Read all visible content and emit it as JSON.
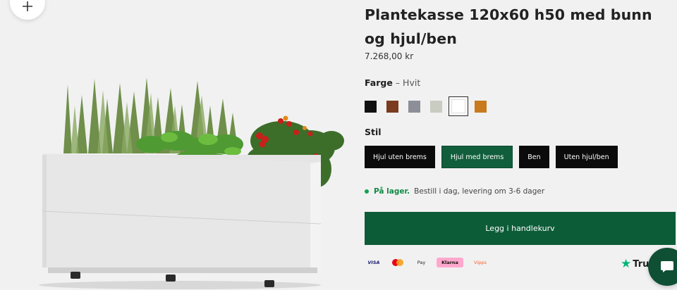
{
  "product": {
    "title": "Plantekasse 120x60 h50 med bunn og hjul/ben",
    "price": "7.268,00 kr"
  },
  "color": {
    "label": "Farge",
    "separator": " – ",
    "selected_value": "Hvit",
    "swatches": [
      {
        "name": "black",
        "hex": "#111111"
      },
      {
        "name": "brown",
        "hex": "#7a3b1e"
      },
      {
        "name": "grey",
        "hex": "#8d8f98"
      },
      {
        "name": "light-grey",
        "hex": "#c9ccc0"
      },
      {
        "name": "white",
        "hex": "#ffffff",
        "selected": true
      },
      {
        "name": "orange",
        "hex": "#c87a1c"
      }
    ]
  },
  "style": {
    "label": "Stil",
    "options": [
      "Hjul uten brems",
      "Hjul med brems",
      "Ben",
      "Uten hjul/ben"
    ],
    "active_index": 1
  },
  "stock": {
    "status": "På lager.",
    "eta": "Bestill i dag, levering om 3-6 dager"
  },
  "cart": {
    "button_label": "Legg i handlekurv"
  },
  "payments": {
    "visa": "VISA",
    "apple_pay": "Pay",
    "klarna": "Klarna",
    "vipps": "Vipps"
  },
  "trustpilot": {
    "text": "Tru"
  },
  "colors": {
    "brand_green": "#0d5c38",
    "stock_green": "#12a150",
    "background": "#f1f1f1"
  }
}
